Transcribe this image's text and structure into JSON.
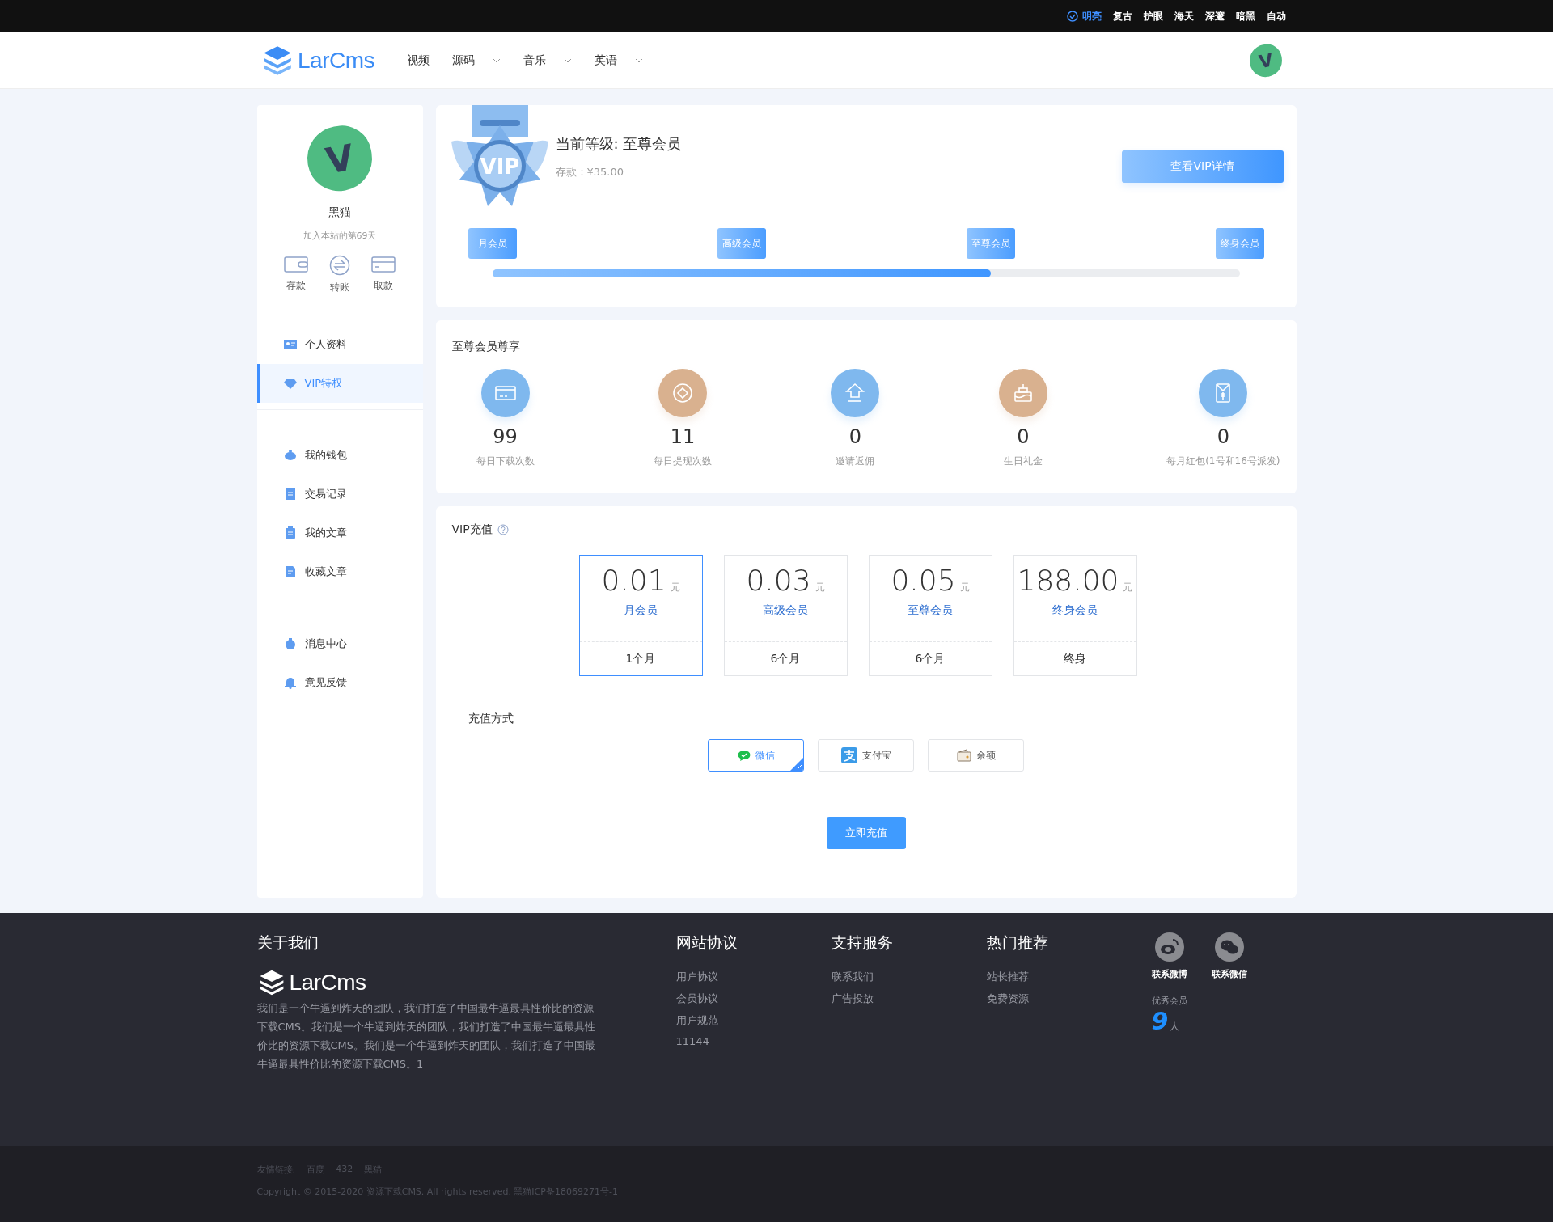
{
  "theme_bar": [
    {
      "label": "明亮",
      "selected": true
    },
    {
      "label": "复古",
      "selected": false
    },
    {
      "label": "护眼",
      "selected": false
    },
    {
      "label": "海天",
      "selected": false
    },
    {
      "label": "深邃",
      "selected": false
    },
    {
      "label": "暗黑",
      "selected": false
    },
    {
      "label": "自动",
      "selected": false
    }
  ],
  "header": {
    "logo": "LarCms",
    "nav": [
      {
        "label": "视频",
        "dropdown": false
      },
      {
        "label": "源码",
        "dropdown": true
      },
      {
        "label": "音乐",
        "dropdown": true
      },
      {
        "label": "英语",
        "dropdown": true
      }
    ],
    "avatar_letter": "V"
  },
  "sidebar": {
    "avatar_letter": "V",
    "name": "黑猫",
    "joined": "加入本站的第69天",
    "actions": [
      {
        "kind": "deposit",
        "label": "存款"
      },
      {
        "kind": "transfer",
        "label": "转账"
      },
      {
        "kind": "withdraw",
        "label": "取款"
      }
    ],
    "groups": [
      [
        {
          "kind": "profile",
          "label": "个人资料",
          "selected": false
        },
        {
          "kind": "vip",
          "label": "VIP特权",
          "selected": true
        }
      ],
      [
        {
          "kind": "wallet",
          "label": "我的钱包",
          "selected": false
        },
        {
          "kind": "records",
          "label": "交易记录",
          "selected": false
        },
        {
          "kind": "articles",
          "label": "我的文章",
          "selected": false
        },
        {
          "kind": "favorites",
          "label": "收藏文章",
          "selected": false
        }
      ],
      [
        {
          "kind": "messages",
          "label": "消息中心",
          "selected": false
        },
        {
          "kind": "feedback",
          "label": "意见反馈",
          "selected": false
        }
      ]
    ]
  },
  "level_card": {
    "medal_label": "VIP",
    "title": "当前等级: 至尊会员",
    "balance": "存款：¥35.00",
    "detail_button": "查看VIP详情",
    "tiers": [
      "月会员",
      "高级会员",
      "至尊会员",
      "终身会员"
    ],
    "progress": {
      "level": 0.667
    }
  },
  "privileges": {
    "title": "至尊会员尊享",
    "items": [
      {
        "kind": "download",
        "color": "#7fb8ee",
        "value": "99",
        "label": "每日下载次数"
      },
      {
        "kind": "withdraw",
        "color": "#d9b18f",
        "value": "11",
        "label": "每日提现次数"
      },
      {
        "kind": "invite",
        "color": "#7fb8ee",
        "value": "0",
        "label": "邀请返佣"
      },
      {
        "kind": "birthday",
        "color": "#d9b18f",
        "value": "0",
        "label": "生日礼金"
      },
      {
        "kind": "redpacket",
        "color": "#7fb8ee",
        "value": "0",
        "label": "每月红包(1号和16号派发)"
      }
    ]
  },
  "recharge": {
    "title": "VIP充值",
    "plans": [
      {
        "price": "0.01",
        "unit": "元",
        "name": "月会员",
        "duration": "1个月",
        "selected": true
      },
      {
        "price": "0.03",
        "unit": "元",
        "name": "高级会员",
        "duration": "6个月",
        "selected": false
      },
      {
        "price": "0.05",
        "unit": "元",
        "name": "至尊会员",
        "duration": "6个月",
        "selected": false
      },
      {
        "price": "188.00",
        "unit": "元",
        "name": "终身会员",
        "duration": "终身",
        "selected": false
      }
    ],
    "method_label": "充值方式",
    "methods": [
      {
        "kind": "wechat",
        "label": "微信",
        "selected": true
      },
      {
        "kind": "alipay",
        "label": "支付宝",
        "selected": false
      },
      {
        "kind": "balance",
        "label": "余额",
        "selected": false
      }
    ],
    "submit": "立即充值"
  },
  "footer": {
    "about": {
      "title": "关于我们",
      "logo": "LarCms",
      "text": "我们是一个牛逼到炸天的团队，我们打造了中国最牛逼最具性价比的资源下载CMS。我们是一个牛逼到炸天的团队，我们打造了中国最牛逼最具性价比的资源下载CMS。我们是一个牛逼到炸天的团队，我们打造了中国最牛逼最具性价比的资源下载CMS。1"
    },
    "columns": [
      {
        "title": "网站协议",
        "links": [
          "用户协议",
          "会员协议",
          "用户规范",
          "11144"
        ]
      },
      {
        "title": "支持服务",
        "links": [
          "联系我们",
          "广告投放"
        ]
      },
      {
        "title": "热门推荐",
        "links": [
          "站长推荐",
          "免费资源"
        ]
      }
    ],
    "social": [
      {
        "kind": "weibo",
        "label": "联系微博"
      },
      {
        "kind": "wechat",
        "label": "联系微信"
      }
    ],
    "members_label": "优秀会员",
    "members_count": "9",
    "members_unit": "人",
    "friend_links_label": "友情链接:",
    "friend_links": [
      "百度",
      "432",
      "黑猫"
    ],
    "copyright": "Copyright © 2015-2020 资源下载CMS. All rights reserved. 黑猫ICP备18069271号-1"
  }
}
